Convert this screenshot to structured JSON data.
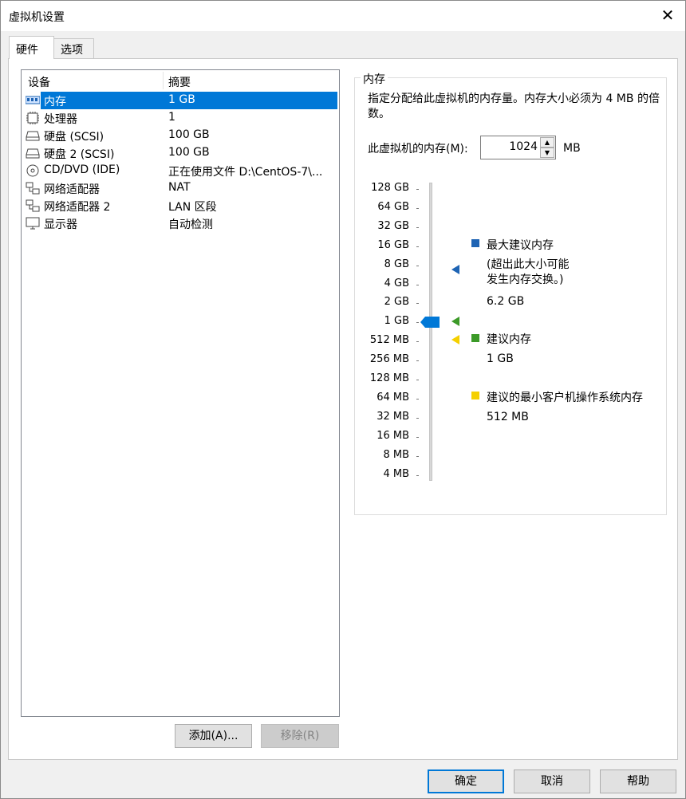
{
  "window": {
    "title": "虚拟机设置",
    "close": "✕"
  },
  "tabs": [
    {
      "label": "硬件"
    },
    {
      "label": "选项"
    }
  ],
  "device_list": {
    "columns": [
      "设备",
      "摘要"
    ],
    "rows": [
      {
        "name": "内存",
        "summary": "1 GB",
        "icon": "memory-icon"
      },
      {
        "name": "处理器",
        "summary": "1",
        "icon": "processor-icon"
      },
      {
        "name": "硬盘 (SCSI)",
        "summary": "100 GB",
        "icon": "hard-disk-icon"
      },
      {
        "name": "硬盘 2 (SCSI)",
        "summary": "100 GB",
        "icon": "hard-disk-icon"
      },
      {
        "name": "CD/DVD (IDE)",
        "summary": "正在使用文件 D:\\CentOS-7\\...",
        "icon": "cd-dvd-icon"
      },
      {
        "name": "网络适配器",
        "summary": "NAT",
        "icon": "network-adapter-icon"
      },
      {
        "name": "网络适配器 2",
        "summary": "LAN 区段",
        "icon": "network-adapter-icon"
      },
      {
        "name": "显示器",
        "summary": "自动检测",
        "icon": "display-icon"
      }
    ]
  },
  "buttons": {
    "add": "添加(A)...",
    "remove": "移除(R)",
    "ok": "确定",
    "cancel": "取消",
    "help": "帮助"
  },
  "memory": {
    "group_title": "内存",
    "description": "指定分配给此虚拟机的内存量。内存大小必须为 4 MB 的倍数。",
    "field_label": "此虚拟机的内存(M):",
    "value": "1024",
    "unit": "MB",
    "scale": [
      "128 GB",
      "64 GB",
      "32 GB",
      "16 GB",
      "8 GB",
      "4 GB",
      "2 GB",
      "1 GB",
      "512 MB",
      "256 MB",
      "128 MB",
      "64 MB",
      "32 MB",
      "16 MB",
      "8 MB",
      "4 MB"
    ],
    "slider_index": 7,
    "legend": {
      "max": {
        "label": "最大建议内存",
        "note": "(超出此大小可能\n发生内存交换。)",
        "value": "6.2 GB",
        "color": "#1e64b4"
      },
      "recommended": {
        "label": "建议内存",
        "value": "1 GB",
        "color": "#3c9a28"
      },
      "min": {
        "label": "建议的最小客户机操作系统内存",
        "value": "512 MB",
        "color": "#f5d000"
      }
    }
  }
}
